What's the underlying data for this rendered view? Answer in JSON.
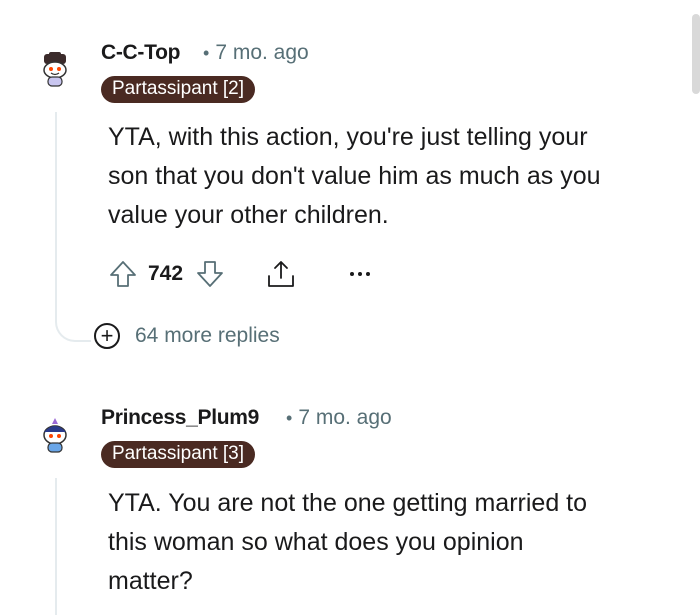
{
  "comments": [
    {
      "author": "C-C-Top",
      "time": "7 mo. ago",
      "flair": "Partassipant [2]",
      "body_lines": [
        "YTA, with this action, you're just telling your",
        "son that you don't value him as much as you",
        "value your other children."
      ],
      "votes": "742",
      "more_replies": "64 more replies",
      "avatar_icon": "snoo-avatar-icon"
    },
    {
      "author": "Princess_Plum9",
      "time": "7 mo. ago",
      "flair": "Partassipant [3]",
      "body_lines": [
        "YTA. You are not the one getting married to",
        "this woman so what does you opinion",
        "matter?"
      ],
      "avatar_icon": "snoo-avatar-icon"
    }
  ],
  "meta_separator": "•",
  "more_glyph": "+",
  "colors": {
    "flair_bg": "#4a2a22",
    "meta_text": "#576f76",
    "thread_line": "#e5ebee"
  }
}
